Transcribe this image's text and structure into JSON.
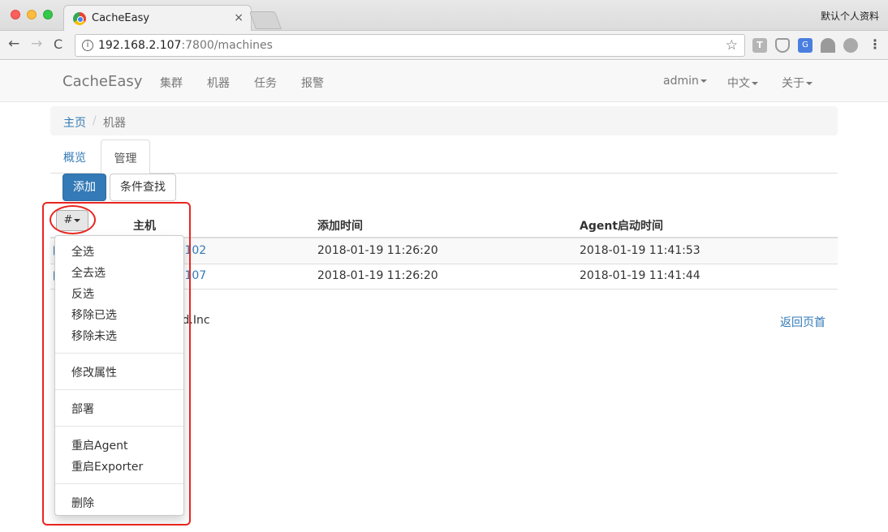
{
  "browser": {
    "tab_title": "CacheEasy",
    "tab_close": "×",
    "profile": "默认个人资料",
    "url_host": "192.168.2.107",
    "url_path": ":7800/machines",
    "back": "←",
    "forward": "→",
    "reload": "C",
    "info": "i",
    "star": "☆",
    "ext_t": "T",
    "ext_translate": "G",
    "menu": "⋮"
  },
  "navbar": {
    "brand": "CacheEasy",
    "links": [
      "集群",
      "机器",
      "任务",
      "报警"
    ],
    "user": "admin",
    "lang": "中文",
    "about": "关于"
  },
  "breadcrumb": {
    "home": "主页",
    "sep": "/",
    "current": "机器"
  },
  "tabs": {
    "overview": "概览",
    "manage": "管理"
  },
  "buttons": {
    "add": "添加",
    "search": "条件查找"
  },
  "table": {
    "headers": [
      "#",
      "主机",
      "添加时间",
      "Agent启动时间"
    ],
    "rows": [
      {
        "host_visible": ".102",
        "added": "2018-01-19 11:26:20",
        "agent_start": "2018-01-19 11:41:53"
      },
      {
        "host_visible": ".107",
        "added": "2018-01-19 11:26:20",
        "agent_start": "2018-01-19 11:41:44"
      }
    ]
  },
  "footer": {
    "copyright_visible": "eld.Inc",
    "back_to_top": "返回页首"
  },
  "dropdown": {
    "groups": [
      [
        "全选",
        "全去选",
        "反选",
        "移除已选",
        "移除未选"
      ],
      [
        "修改属性"
      ],
      [
        "部署"
      ],
      [
        "重启Agent",
        "重启Exporter"
      ],
      [
        "删除"
      ]
    ]
  },
  "colors": {
    "primary": "#337ab7",
    "highlight": "#e8261f"
  }
}
